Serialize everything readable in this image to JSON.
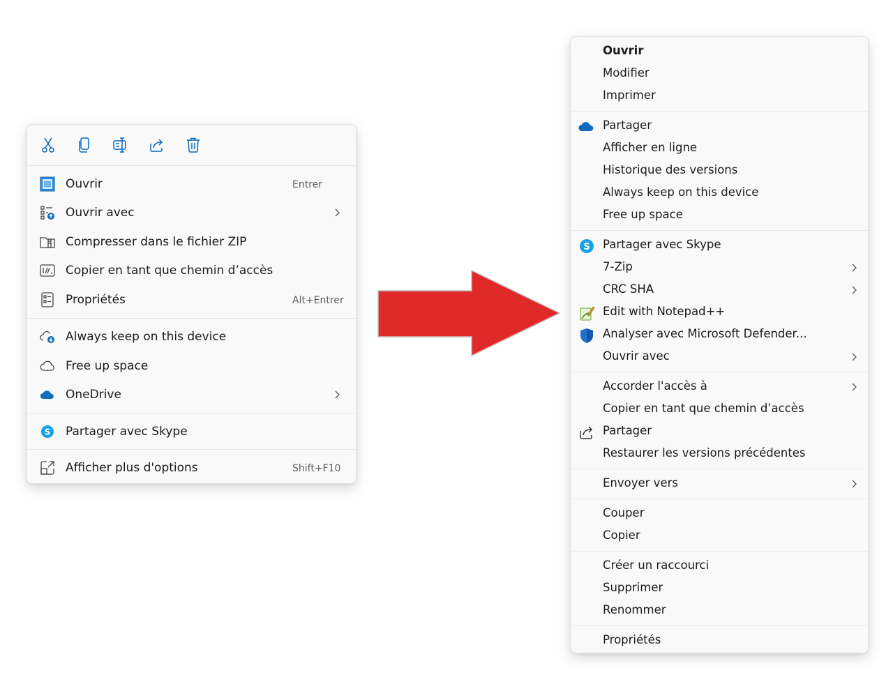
{
  "new_menu": {
    "toolbar": [
      {
        "name": "cut-icon"
      },
      {
        "name": "copy-icon"
      },
      {
        "name": "rename-icon"
      },
      {
        "name": "share-icon"
      },
      {
        "name": "delete-icon"
      }
    ],
    "items": [
      {
        "label": "Ouvrir",
        "shortcut": "Entrer",
        "icon": "open-app-icon"
      },
      {
        "label": "Ouvrir avec",
        "submenu": true,
        "icon": "open-with-icon"
      },
      {
        "label": "Compresser dans le fichier ZIP",
        "icon": "zip-icon"
      },
      {
        "label": "Copier en tant que chemin d’accès",
        "icon": "copy-path-icon"
      },
      {
        "label": "Propriétés",
        "shortcut": "Alt+Entrer",
        "icon": "properties-icon"
      },
      {
        "label": "Always keep on this device",
        "icon": "cloud-sync-icon"
      },
      {
        "label": "Free up space",
        "icon": "cloud-outline-icon"
      },
      {
        "label": "OneDrive",
        "submenu": true,
        "icon": "onedrive-icon"
      },
      {
        "label": "Partager avec Skype",
        "icon": "skype-icon"
      },
      {
        "label": "Afficher plus d'options",
        "shortcut": "Shift+F10",
        "icon": "more-options-icon"
      }
    ]
  },
  "old_menu": {
    "items": [
      {
        "label": "Ouvrir",
        "bold": true
      },
      {
        "label": "Modifier"
      },
      {
        "label": "Imprimer"
      },
      {
        "label": "Partager",
        "icon": "onedrive-icon"
      },
      {
        "label": "Afficher en ligne"
      },
      {
        "label": "Historique des versions"
      },
      {
        "label": "Always keep on this device"
      },
      {
        "label": "Free up space"
      },
      {
        "label": "Partager avec Skype",
        "icon": "skype-icon"
      },
      {
        "label": "7-Zip",
        "submenu": true
      },
      {
        "label": "CRC SHA",
        "submenu": true
      },
      {
        "label": "Edit with Notepad++",
        "icon": "notepadpp-icon"
      },
      {
        "label": "Analyser avec Microsoft Defender...",
        "icon": "defender-shield-icon"
      },
      {
        "label": "Ouvrir avec",
        "submenu": true
      },
      {
        "label": "Accorder l'accès à",
        "submenu": true
      },
      {
        "label": "Copier en tant que chemin d’accès"
      },
      {
        "label": "Partager",
        "icon": "share-icon"
      },
      {
        "label": "Restaurer les versions précédentes"
      },
      {
        "label": "Envoyer vers",
        "submenu": true
      },
      {
        "label": "Couper"
      },
      {
        "label": "Copier"
      },
      {
        "label": "Créer un raccourci"
      },
      {
        "label": "Supprimer"
      },
      {
        "label": "Renommer"
      },
      {
        "label": "Propriétés"
      }
    ]
  },
  "colors": {
    "accent_blue": "#0067c0",
    "onedrive_blue": "#0f6cbd",
    "skype_blue": "#1aa0e6",
    "arrow_red": "#e02a2a"
  }
}
